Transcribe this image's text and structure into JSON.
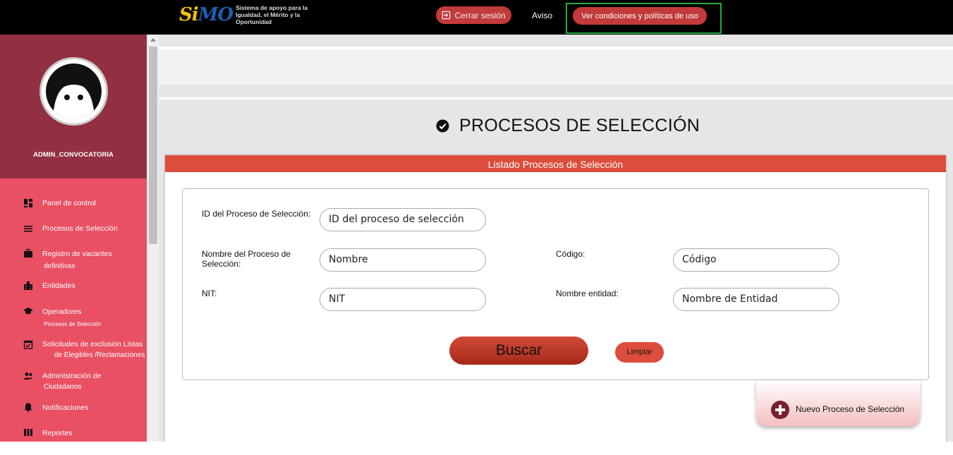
{
  "header": {
    "logo_mark": "SiMO",
    "logo_text": "Sistema de apoyo para la Igualdad, el Mérito y la Oportunidad",
    "logout_label": "Cerrar sesión",
    "aviso_label": "Aviso",
    "conditions_label": "Ver condiciones y políticas de uso"
  },
  "sidebar": {
    "username": "ADMIN_CONVOCATORIA",
    "items": [
      {
        "label": "Panel de control",
        "icon": "dashboard-icon"
      },
      {
        "label": "Procesos de Selección",
        "icon": "list-icon"
      },
      {
        "label": "Registro de vacantes",
        "sub": "definitivas",
        "icon": "briefcase-icon"
      },
      {
        "label": "Entidades",
        "icon": "building-icon"
      },
      {
        "label": "Operadores",
        "sub": "Procesos de Selección",
        "icon": "graduation-cap-icon"
      },
      {
        "label": "Solicitudes de exclusión Listas",
        "sub": "de Elegibles /Reclamaciones",
        "icon": "calendar-check-icon"
      },
      {
        "label": "Administración de",
        "sub": "Ciudadanos",
        "icon": "people-icon"
      },
      {
        "label": "Notificaciones",
        "icon": "bell-icon"
      },
      {
        "label": "Reportes",
        "icon": "columns-icon"
      }
    ]
  },
  "main": {
    "page_title": "PROCESOS DE SELECCIÓN",
    "panel_title": "Listado Procesos de Selección",
    "form": {
      "id_label": "ID del Proceso de Selección:",
      "id_placeholder": "ID del proceso de selección",
      "name_label": "Nombre del Proceso de Selección:",
      "name_placeholder": "Nombre",
      "code_label": "Código:",
      "code_placeholder": "Código",
      "nit_label": "NIT:",
      "nit_placeholder": "NIT",
      "entity_label": "Nombre entidad:",
      "entity_placeholder": "Nombre de Entidad",
      "search_label": "Buscar",
      "clear_label": "Limpiar"
    },
    "new_process_label": "Nuevo Proceso de Selección"
  },
  "colors": {
    "sidebar_top": "#922f40",
    "sidebar_menu": "#e95063",
    "panel_header": "#dd4d3c",
    "highlight": "#27a844"
  }
}
